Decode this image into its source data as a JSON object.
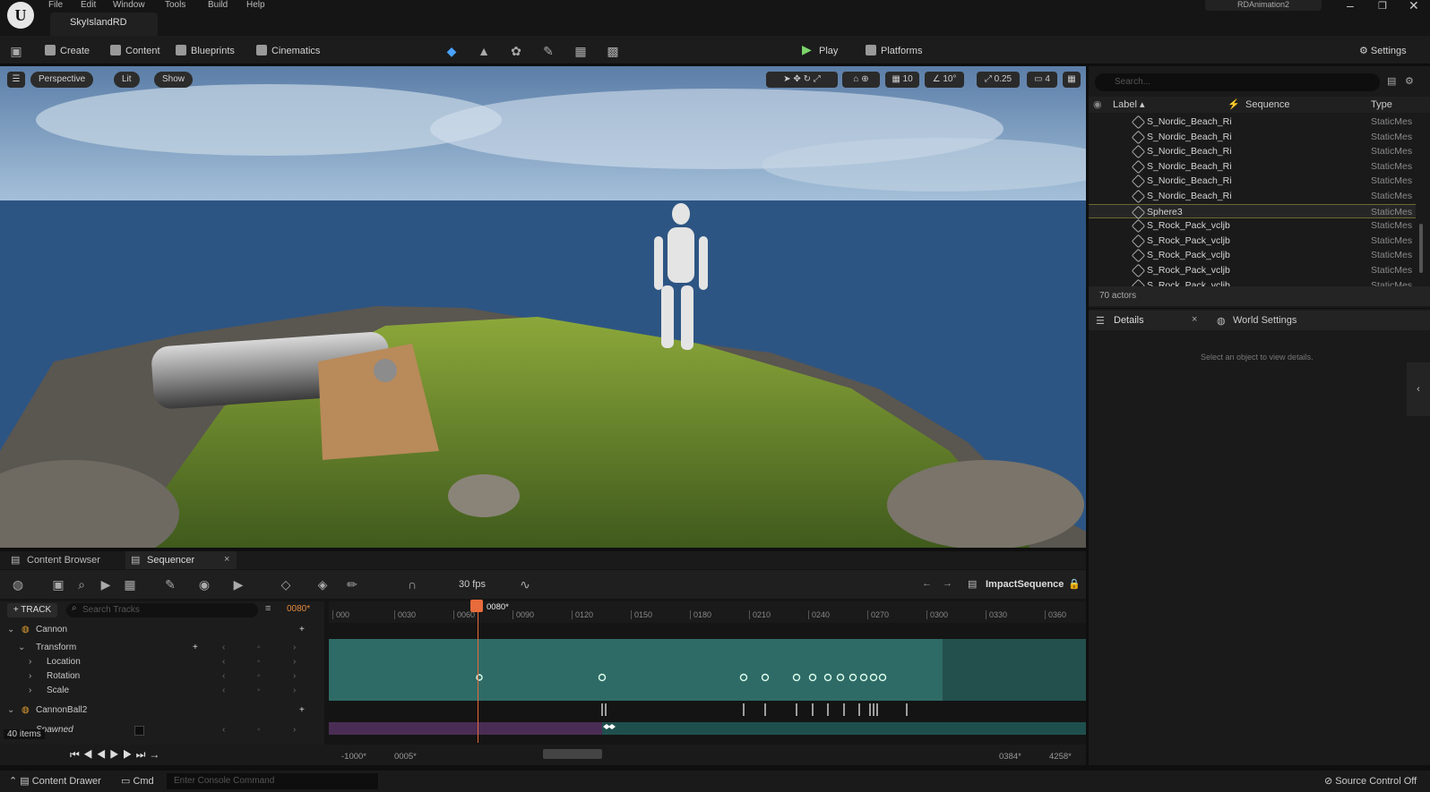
{
  "window": {
    "menus": [
      "File",
      "Edit",
      "Window",
      "Tools",
      "Build",
      "Help"
    ],
    "project_tab": "SkyIslandRD",
    "title": "RDAnimation2",
    "controls": [
      "–",
      "❐",
      "✕"
    ]
  },
  "toolbar": {
    "create": "Create",
    "content": "Content",
    "blueprints": "Blueprints",
    "cinematics": "Cinematics",
    "play": "Play",
    "platforms": "Platforms",
    "settings": "Settings"
  },
  "viewport": {
    "perspective": "Perspective",
    "lit": "Lit",
    "show": "Show",
    "grid_snap": "10",
    "angle_snap": "10°",
    "scale_snap": "0.25",
    "camera_speed": "4"
  },
  "outliner": {
    "search_placeholder": "Search...",
    "col_label": "Label",
    "col_sequence": "Sequence",
    "col_type": "Type",
    "rows": [
      {
        "label": "S_Nordic_Beach_Ri",
        "type": "StaticMes"
      },
      {
        "label": "S_Nordic_Beach_Ri",
        "type": "StaticMes"
      },
      {
        "label": "S_Nordic_Beach_Ri",
        "type": "StaticMes"
      },
      {
        "label": "S_Nordic_Beach_Ri",
        "type": "StaticMes"
      },
      {
        "label": "S_Nordic_Beach_Ri",
        "type": "StaticMes"
      },
      {
        "label": "S_Nordic_Beach_Ri",
        "type": "StaticMes"
      },
      {
        "label": "Sphere3",
        "type": "StaticMes"
      },
      {
        "label": "S_Rock_Pack_vcljb",
        "type": "StaticMes"
      },
      {
        "label": "S_Rock_Pack_vcljb",
        "type": "StaticMes"
      },
      {
        "label": "S_Rock_Pack_vcljb",
        "type": "StaticMes"
      },
      {
        "label": "S_Rock_Pack_vcljb",
        "type": "StaticMes"
      },
      {
        "label": "S_Rock_Pack_vcljb",
        "type": "StaticMes"
      }
    ],
    "actor_count": "70 actors"
  },
  "details": {
    "tab_details": "Details",
    "tab_world": "World Settings",
    "empty_msg": "Select an object to view details."
  },
  "sequencer": {
    "tab_content_browser": "Content Browser",
    "tab_sequencer": "Sequencer",
    "fps": "30 fps",
    "sequence_name": "ImpactSequence",
    "add_track": "+ TRACK",
    "search_tracks_placeholder": "Search Tracks",
    "current_frame": "0080*",
    "playhead_label": "0080*",
    "ruler_ticks": [
      "000",
      "0030",
      "0060",
      "0090",
      "0120",
      "0150",
      "0180",
      "0210",
      "0240",
      "0270",
      "0300",
      "0330",
      "0360"
    ],
    "tracks": [
      {
        "label": "Cannon",
        "indent": 0
      },
      {
        "label": "Transform",
        "indent": 1
      },
      {
        "label": "Location",
        "indent": 2
      },
      {
        "label": "Rotation",
        "indent": 2
      },
      {
        "label": "Scale",
        "indent": 2
      },
      {
        "label": "CannonBall2",
        "indent": 0
      },
      {
        "label": "Spawned",
        "indent": 1
      }
    ],
    "items_count": "40 items",
    "range_start": "-1000*",
    "view_start": "0005*",
    "view_end": "0384*",
    "range_end": "4258*"
  },
  "statusbar": {
    "content_drawer": "Content Drawer",
    "cmd": "Cmd",
    "console_placeholder": "Enter Console Command",
    "source_control": "Source Control Off"
  },
  "colors": {
    "accent_play": "#7bd36a",
    "playhead": "#e86b3c",
    "track_teal": "#2f6b66",
    "spawn_purple": "#4a2d54"
  }
}
